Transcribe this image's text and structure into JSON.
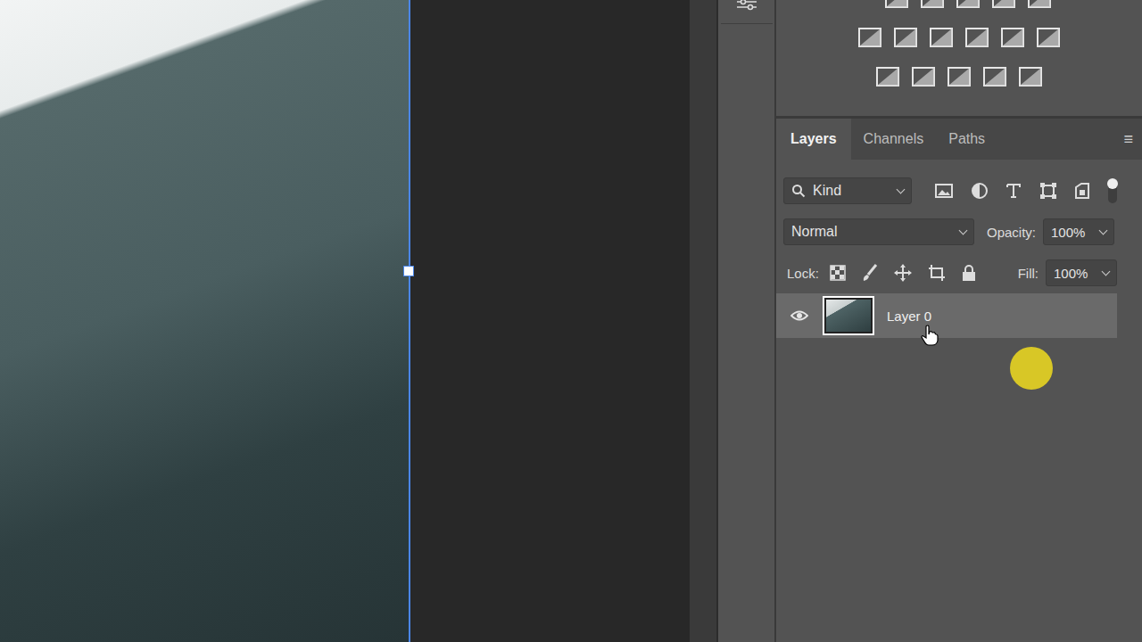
{
  "panel": {
    "tabs": [
      {
        "label": "Layers",
        "selected": true
      },
      {
        "label": "Channels",
        "selected": false
      },
      {
        "label": "Paths",
        "selected": false
      }
    ],
    "menu_icon": "≡"
  },
  "filter": {
    "label": "Kind",
    "enabled": true
  },
  "blend_mode": {
    "value": "Normal"
  },
  "opacity": {
    "label": "Opacity:",
    "value": "100%"
  },
  "lock": {
    "label": "Lock:"
  },
  "fill": {
    "label": "Fill:",
    "value": "100%"
  },
  "layers": [
    {
      "name": "Layer 0",
      "visible": true,
      "selected": true
    }
  ]
}
